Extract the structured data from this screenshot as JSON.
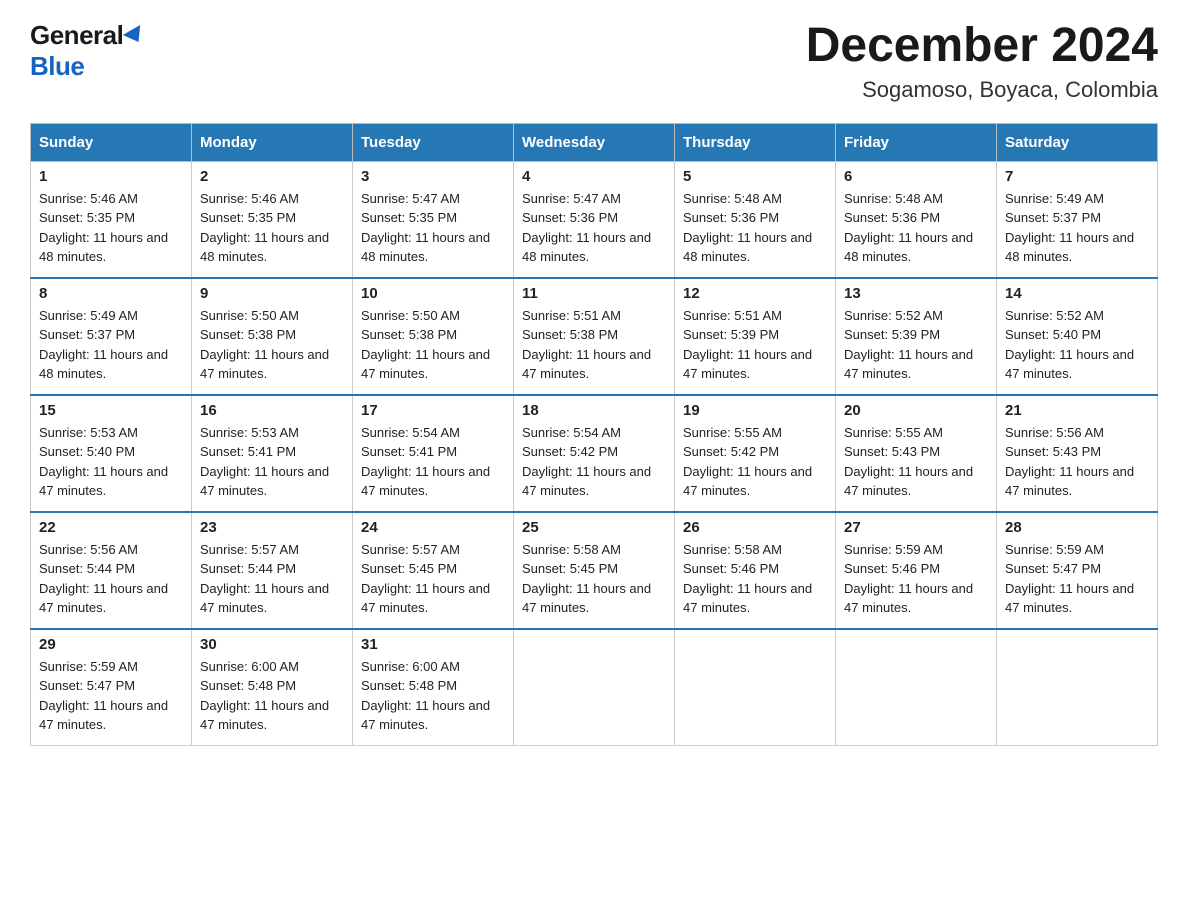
{
  "header": {
    "logo_general": "General",
    "logo_blue": "Blue",
    "title": "December 2024",
    "subtitle": "Sogamoso, Boyaca, Colombia"
  },
  "weekdays": [
    "Sunday",
    "Monday",
    "Tuesday",
    "Wednesday",
    "Thursday",
    "Friday",
    "Saturday"
  ],
  "weeks": [
    [
      {
        "day": "1",
        "sunrise": "Sunrise: 5:46 AM",
        "sunset": "Sunset: 5:35 PM",
        "daylight": "Daylight: 11 hours and 48 minutes."
      },
      {
        "day": "2",
        "sunrise": "Sunrise: 5:46 AM",
        "sunset": "Sunset: 5:35 PM",
        "daylight": "Daylight: 11 hours and 48 minutes."
      },
      {
        "day": "3",
        "sunrise": "Sunrise: 5:47 AM",
        "sunset": "Sunset: 5:35 PM",
        "daylight": "Daylight: 11 hours and 48 minutes."
      },
      {
        "day": "4",
        "sunrise": "Sunrise: 5:47 AM",
        "sunset": "Sunset: 5:36 PM",
        "daylight": "Daylight: 11 hours and 48 minutes."
      },
      {
        "day": "5",
        "sunrise": "Sunrise: 5:48 AM",
        "sunset": "Sunset: 5:36 PM",
        "daylight": "Daylight: 11 hours and 48 minutes."
      },
      {
        "day": "6",
        "sunrise": "Sunrise: 5:48 AM",
        "sunset": "Sunset: 5:36 PM",
        "daylight": "Daylight: 11 hours and 48 minutes."
      },
      {
        "day": "7",
        "sunrise": "Sunrise: 5:49 AM",
        "sunset": "Sunset: 5:37 PM",
        "daylight": "Daylight: 11 hours and 48 minutes."
      }
    ],
    [
      {
        "day": "8",
        "sunrise": "Sunrise: 5:49 AM",
        "sunset": "Sunset: 5:37 PM",
        "daylight": "Daylight: 11 hours and 48 minutes."
      },
      {
        "day": "9",
        "sunrise": "Sunrise: 5:50 AM",
        "sunset": "Sunset: 5:38 PM",
        "daylight": "Daylight: 11 hours and 47 minutes."
      },
      {
        "day": "10",
        "sunrise": "Sunrise: 5:50 AM",
        "sunset": "Sunset: 5:38 PM",
        "daylight": "Daylight: 11 hours and 47 minutes."
      },
      {
        "day": "11",
        "sunrise": "Sunrise: 5:51 AM",
        "sunset": "Sunset: 5:38 PM",
        "daylight": "Daylight: 11 hours and 47 minutes."
      },
      {
        "day": "12",
        "sunrise": "Sunrise: 5:51 AM",
        "sunset": "Sunset: 5:39 PM",
        "daylight": "Daylight: 11 hours and 47 minutes."
      },
      {
        "day": "13",
        "sunrise": "Sunrise: 5:52 AM",
        "sunset": "Sunset: 5:39 PM",
        "daylight": "Daylight: 11 hours and 47 minutes."
      },
      {
        "day": "14",
        "sunrise": "Sunrise: 5:52 AM",
        "sunset": "Sunset: 5:40 PM",
        "daylight": "Daylight: 11 hours and 47 minutes."
      }
    ],
    [
      {
        "day": "15",
        "sunrise": "Sunrise: 5:53 AM",
        "sunset": "Sunset: 5:40 PM",
        "daylight": "Daylight: 11 hours and 47 minutes."
      },
      {
        "day": "16",
        "sunrise": "Sunrise: 5:53 AM",
        "sunset": "Sunset: 5:41 PM",
        "daylight": "Daylight: 11 hours and 47 minutes."
      },
      {
        "day": "17",
        "sunrise": "Sunrise: 5:54 AM",
        "sunset": "Sunset: 5:41 PM",
        "daylight": "Daylight: 11 hours and 47 minutes."
      },
      {
        "day": "18",
        "sunrise": "Sunrise: 5:54 AM",
        "sunset": "Sunset: 5:42 PM",
        "daylight": "Daylight: 11 hours and 47 minutes."
      },
      {
        "day": "19",
        "sunrise": "Sunrise: 5:55 AM",
        "sunset": "Sunset: 5:42 PM",
        "daylight": "Daylight: 11 hours and 47 minutes."
      },
      {
        "day": "20",
        "sunrise": "Sunrise: 5:55 AM",
        "sunset": "Sunset: 5:43 PM",
        "daylight": "Daylight: 11 hours and 47 minutes."
      },
      {
        "day": "21",
        "sunrise": "Sunrise: 5:56 AM",
        "sunset": "Sunset: 5:43 PM",
        "daylight": "Daylight: 11 hours and 47 minutes."
      }
    ],
    [
      {
        "day": "22",
        "sunrise": "Sunrise: 5:56 AM",
        "sunset": "Sunset: 5:44 PM",
        "daylight": "Daylight: 11 hours and 47 minutes."
      },
      {
        "day": "23",
        "sunrise": "Sunrise: 5:57 AM",
        "sunset": "Sunset: 5:44 PM",
        "daylight": "Daylight: 11 hours and 47 minutes."
      },
      {
        "day": "24",
        "sunrise": "Sunrise: 5:57 AM",
        "sunset": "Sunset: 5:45 PM",
        "daylight": "Daylight: 11 hours and 47 minutes."
      },
      {
        "day": "25",
        "sunrise": "Sunrise: 5:58 AM",
        "sunset": "Sunset: 5:45 PM",
        "daylight": "Daylight: 11 hours and 47 minutes."
      },
      {
        "day": "26",
        "sunrise": "Sunrise: 5:58 AM",
        "sunset": "Sunset: 5:46 PM",
        "daylight": "Daylight: 11 hours and 47 minutes."
      },
      {
        "day": "27",
        "sunrise": "Sunrise: 5:59 AM",
        "sunset": "Sunset: 5:46 PM",
        "daylight": "Daylight: 11 hours and 47 minutes."
      },
      {
        "day": "28",
        "sunrise": "Sunrise: 5:59 AM",
        "sunset": "Sunset: 5:47 PM",
        "daylight": "Daylight: 11 hours and 47 minutes."
      }
    ],
    [
      {
        "day": "29",
        "sunrise": "Sunrise: 5:59 AM",
        "sunset": "Sunset: 5:47 PM",
        "daylight": "Daylight: 11 hours and 47 minutes."
      },
      {
        "day": "30",
        "sunrise": "Sunrise: 6:00 AM",
        "sunset": "Sunset: 5:48 PM",
        "daylight": "Daylight: 11 hours and 47 minutes."
      },
      {
        "day": "31",
        "sunrise": "Sunrise: 6:00 AM",
        "sunset": "Sunset: 5:48 PM",
        "daylight": "Daylight: 11 hours and 47 minutes."
      },
      null,
      null,
      null,
      null
    ]
  ]
}
